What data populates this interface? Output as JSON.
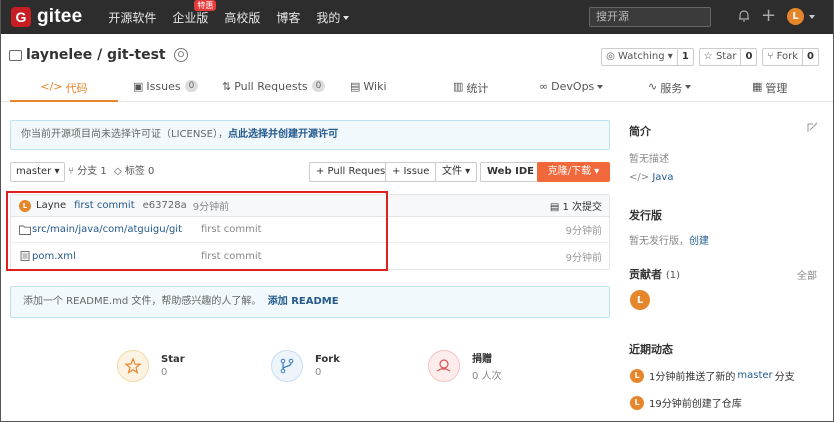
{
  "nav": {
    "logo_text": "gitee",
    "logo_mark": "G",
    "links": [
      "开源软件",
      "企业版",
      "高校版",
      "博客",
      "我的"
    ],
    "enterprise_badge": "特惠",
    "search_placeholder": "搜开源",
    "avatar_initial": "L"
  },
  "repo": {
    "full_name": "laynelee / git-test",
    "watch_label": "Watching",
    "watch_count": "1",
    "star_label": "Star",
    "star_count": "0",
    "fork_label": "Fork",
    "fork_count": "0"
  },
  "tabs": {
    "code": "代码",
    "issues": "Issues",
    "issues_count": "0",
    "pulls": "Pull Requests",
    "pulls_count": "0",
    "wiki": "Wiki",
    "stats": "统计",
    "devops": "DevOps",
    "service": "服务",
    "manage": "管理"
  },
  "license_notice": {
    "text": "你当前开源项目尚未选择许可证（LICENSE），",
    "link": "点此选择并创建开源许可"
  },
  "toolbar": {
    "branch": "master",
    "branches": "分支 1",
    "tags": "标签 0",
    "pull_request": "+ Pull Request",
    "issue": "+ Issue",
    "file": "文件",
    "web_ide": "Web IDE",
    "clone": "克隆/下载"
  },
  "commit": {
    "avatar": "L",
    "author": "Layne",
    "message": "first commit",
    "hash": "e63728a",
    "time": "9分钟前",
    "commits": "1 次提交"
  },
  "files": [
    {
      "name": "src/main/java/com/atguigu/git",
      "commit": "first commit",
      "time": "9分钟前"
    },
    {
      "name": "pom.xml",
      "commit": "first commit",
      "time": "9分钟前"
    }
  ],
  "readme_notice": {
    "text": "添加一个 README.md 文件，帮助感兴趣的人了解。",
    "link": "添加 README"
  },
  "stats": {
    "star_label": "Star",
    "star_value": "0",
    "fork_label": "Fork",
    "fork_value": "0",
    "donate_label": "捐赠",
    "donate_value": "0 人次"
  },
  "sidebar": {
    "intro_title": "简介",
    "intro_text": "暂无描述",
    "language": "Java",
    "release_title": "发行版",
    "release_text": "暂无发行版，",
    "release_link": "创建",
    "contrib_title": "贡献者",
    "contrib_count": "(1)",
    "contrib_all": "全部",
    "contrib_avatar": "L",
    "activity_title": "近期动态",
    "activity": [
      {
        "avatar": "L",
        "pre": "1分钟前推送了新的",
        "hl": "master",
        "post": "分支"
      },
      {
        "avatar": "L",
        "pre": "19分钟前创建了仓库",
        "hl": "",
        "post": ""
      }
    ]
  },
  "colors": {
    "accent": "#e7852a",
    "clone_button": "#f1683a",
    "link": "#245a8d",
    "highlight_box": "#e02020"
  }
}
